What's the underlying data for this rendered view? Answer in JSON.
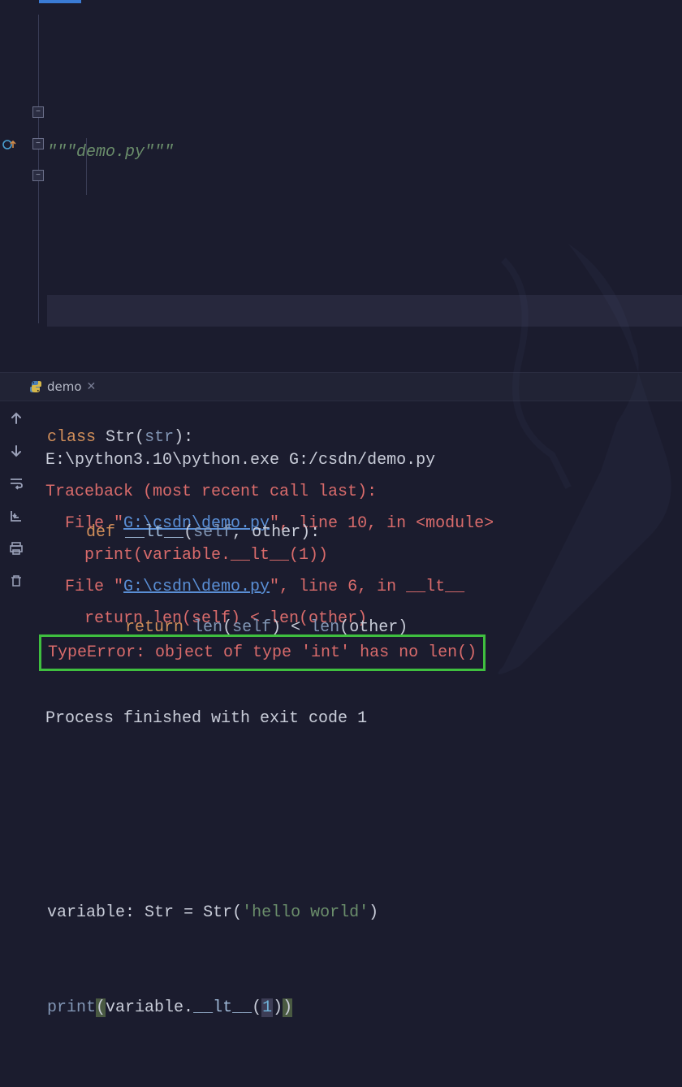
{
  "editor": {
    "line1": "\"\"\"demo.py\"\"\"",
    "class_kw": "class",
    "class_name": "Str",
    "base": "str",
    "def_kw": "def",
    "method": "__lt__",
    "self": "self",
    "other": "other",
    "return_kw": "return",
    "len": "len",
    "lt": "<",
    "var_name": "variable",
    "type_ann": "Str",
    "eq": "=",
    "ctor": "Str",
    "literal": "'hello world'",
    "print": "print",
    "accessor": "__lt__",
    "arg": "1"
  },
  "tab": {
    "label": "demo"
  },
  "console": {
    "lines": {
      "exec": "E:\\python3.10\\python.exe G:/csdn/demo.py",
      "traceback": "Traceback (most recent call last):",
      "file1_pre": "  File \"",
      "file1_link": "G:\\csdn\\demo.py",
      "file1_post": "\", line 10, in <module>",
      "src1": "    print(variable.__lt__(1))",
      "file2_pre": "  File \"",
      "file2_link": "G:\\csdn\\demo.py",
      "file2_post": "\", line 6, in __lt__",
      "src2": "    return len(self) < len(other)",
      "error": "TypeError: object of type 'int' has no len()",
      "exit": "Process finished with exit code 1"
    }
  }
}
